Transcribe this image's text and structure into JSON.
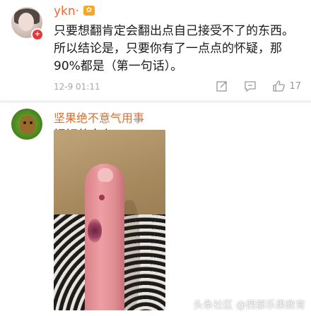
{
  "comments": [
    {
      "username": "ykn·",
      "vip_badge": "✿",
      "avatar_badge": "+",
      "text": "只要想翻肯定会翻出点自己接受不了的东西。所以结论是，只要你有了一点点的怀疑，那90%都是（第一句话）。",
      "time": "12-9 01:11",
      "like_count": "17"
    },
    {
      "username": "坚果绝不意气用事",
      "text": "捉奸的女友："
    }
  ],
  "watermark": "头条社区 @西部乐果教育",
  "colors": {
    "username": "#e86a3a",
    "meta": "#a8a8a8",
    "divider": "#f2f2f2"
  },
  "icons": [
    "share-icon",
    "comment-icon",
    "like-icon",
    "add-badge-icon"
  ]
}
